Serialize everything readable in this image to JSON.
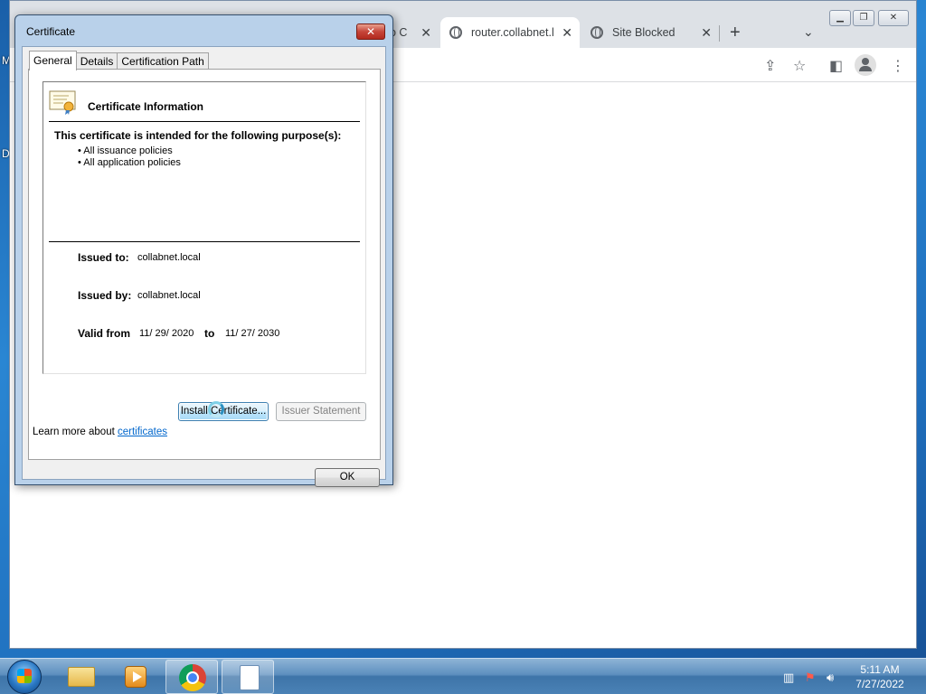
{
  "desktop": {
    "letters": [
      "M",
      "D"
    ]
  },
  "browser": {
    "tabs": [
      {
        "label": "o C",
        "active": false
      },
      {
        "label": "router.collabnet.l",
        "active": true
      },
      {
        "label": "Site Blocked",
        "active": false
      }
    ],
    "new_tab": "+",
    "tab_close": "✕"
  },
  "dialog": {
    "title": "Certificate",
    "tabs": [
      "General",
      "Details",
      "Certification Path"
    ],
    "info_title": "Certificate Information",
    "purpose_heading": "This certificate is intended for the following purpose(s):",
    "purposes": [
      "• All issuance policies",
      "• All application policies"
    ],
    "issued_to_label": "Issued to:",
    "issued_to": "collabnet.local",
    "issued_by_label": "Issued by:",
    "issued_by": "collabnet.local",
    "valid_from_label": "Valid from",
    "valid_from": "11/ 29/ 2020",
    "valid_to_label": "to",
    "valid_to": "11/ 27/ 2030",
    "install_button": "Install Certificate...",
    "issuer_statement_button": "Issuer Statement",
    "learn_more": "Learn more about",
    "learn_link": "certificates",
    "ok_button": "OK",
    "close_glyph": "✕"
  },
  "taskbar": {
    "time": "5:11 AM",
    "date": "7/27/2022"
  }
}
